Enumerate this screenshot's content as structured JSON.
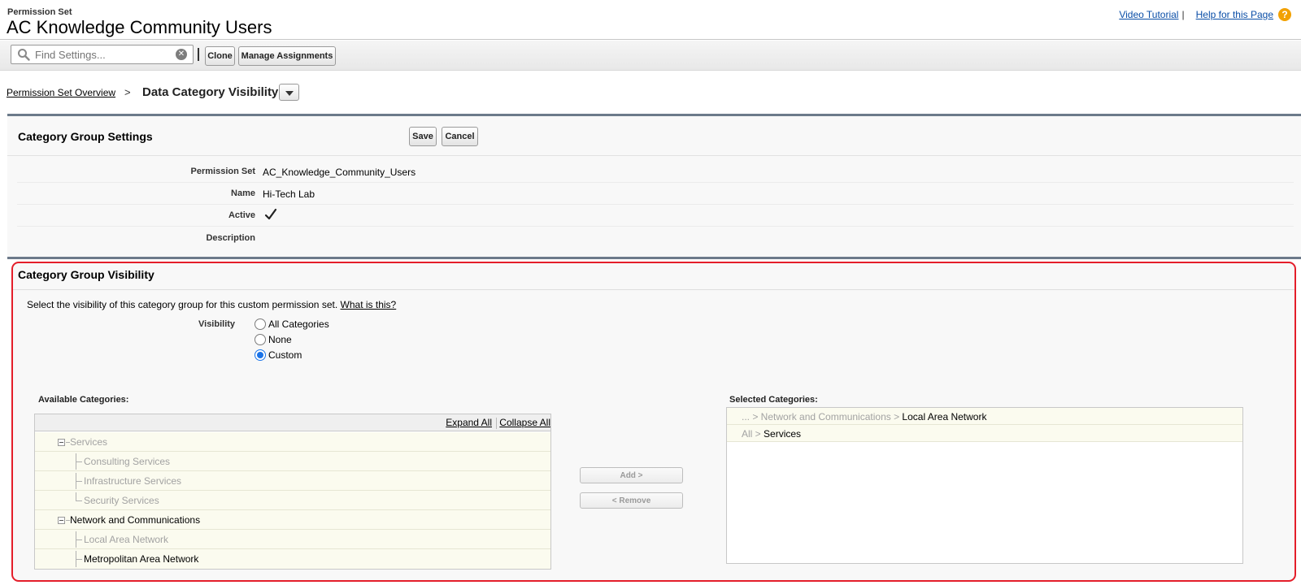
{
  "header": {
    "object_label": "Permission Set",
    "title": "AC Knowledge Community Users",
    "video_tutorial": "Video Tutorial",
    "link_sep": "|",
    "help": "Help for this Page",
    "help_icon": "?"
  },
  "toolbar": {
    "search_placeholder": "Find Settings...",
    "clone": "Clone",
    "manage_assignments": "Manage Assignments"
  },
  "breadcrumb": {
    "parent": "Permission Set Overview",
    "separator": ">",
    "current": "Data Category Visibility"
  },
  "settings": {
    "title": "Category Group Settings",
    "save": "Save",
    "cancel": "Cancel",
    "fields": {
      "permission_set_label": "Permission Set",
      "permission_set_value": "AC_Knowledge_Community_Users",
      "name_label": "Name",
      "name_value": "Hi-Tech Lab",
      "active_label": "Active",
      "active_value": true,
      "description_label": "Description",
      "description_value": ""
    }
  },
  "visibility": {
    "title": "Category Group Visibility",
    "intro": "Select the visibility of this category group for this custom permission set.",
    "what_is_this": "What is this?",
    "visibility_label": "Visibility",
    "options": [
      {
        "label": "All Categories",
        "selected": false
      },
      {
        "label": "None",
        "selected": false
      },
      {
        "label": "Custom",
        "selected": true
      }
    ],
    "available_label": "Available Categories:",
    "expand_all": "Expand All",
    "collapse_all": "Collapse All",
    "tree": [
      {
        "label": "Services",
        "level": 0,
        "enabled": false
      },
      {
        "label": "Consulting Services",
        "level": 1,
        "enabled": false
      },
      {
        "label": "Infrastructure Services",
        "level": 1,
        "enabled": false
      },
      {
        "label": "Security Services",
        "level": 1,
        "enabled": false
      },
      {
        "label": "Network and Communications",
        "level": 0,
        "enabled": true
      },
      {
        "label": "Local Area Network",
        "level": 1,
        "enabled": false
      },
      {
        "label": "Metropolitan Area Network",
        "level": 1,
        "enabled": true
      }
    ],
    "add": "Add >",
    "remove": "< Remove",
    "selected_label": "Selected Categories:",
    "selected": [
      {
        "path": "... > Network and Communications > ",
        "leaf": "Local Area Network"
      },
      {
        "path": "All > ",
        "leaf": "Services"
      }
    ]
  },
  "colors": {
    "link": "#0a4ea7",
    "highlight_border": "#e41e2a",
    "radio_selected": "#1a73e8",
    "help_icon": "#f2a100"
  }
}
